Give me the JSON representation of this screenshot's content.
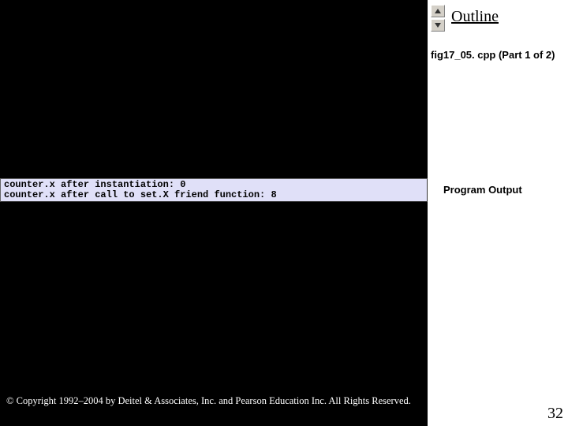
{
  "header": {
    "outline": "Outline",
    "file_label": "fig17_05. cpp (Part 1 of 2)"
  },
  "output": {
    "section_label": "Program Output",
    "line1": "counter.x after instantiation: 0",
    "line2": "counter.x after call to set.X friend function: 8"
  },
  "footer": {
    "copyright": "© Copyright 1992–2004 by Deitel & Associates, Inc. and Pearson Education Inc. All Rights Reserved.",
    "page_number": "32"
  }
}
